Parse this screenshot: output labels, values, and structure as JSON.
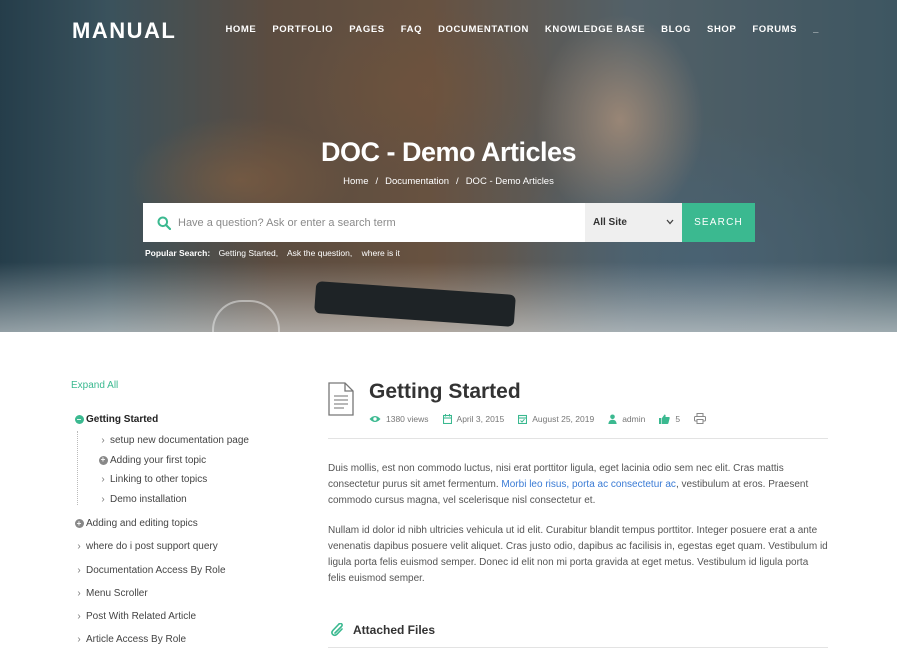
{
  "header": {
    "logo": "MANUAL",
    "nav": [
      "HOME",
      "PORTFOLIO",
      "PAGES",
      "FAQ",
      "DOCUMENTATION",
      "KNOWLEDGE BASE",
      "BLOG",
      "SHOP",
      "FORUMS",
      "_"
    ]
  },
  "hero": {
    "title": "DOC - Demo Articles",
    "breadcrumb": [
      "Home",
      "Documentation",
      "DOC - Demo Articles"
    ],
    "breadcrumb_sep": "/"
  },
  "search": {
    "placeholder": "Have a question? Ask or enter a search term",
    "scope": "All Site",
    "button": "SEARCH",
    "popular_label": "Popular Search:",
    "popular": [
      "Getting Started,",
      "Ask the question,",
      "where is it"
    ]
  },
  "colors": {
    "accent": "#3bb990",
    "link": "#3a7bd5"
  },
  "sidebar": {
    "expand_all": "Expand All",
    "items": [
      {
        "label": "Getting Started",
        "icon": "minus-circle-icon",
        "active": true,
        "children": [
          {
            "label": "setup new documentation page",
            "icon": "chevron-right-icon"
          },
          {
            "label": "Adding your first topic",
            "icon": "plus-circle-icon"
          },
          {
            "label": "Linking to other topics",
            "icon": "chevron-right-icon"
          },
          {
            "label": "Demo installation",
            "icon": "chevron-right-icon"
          }
        ]
      },
      {
        "label": "Adding and editing topics",
        "icon": "plus-circle-icon"
      },
      {
        "label": "where do i post support query",
        "icon": "chevron-right-icon"
      },
      {
        "label": "Documentation Access By Role",
        "icon": "chevron-right-icon"
      },
      {
        "label": "Menu Scroller",
        "icon": "chevron-right-icon"
      },
      {
        "label": "Post With Related Article",
        "icon": "chevron-right-icon"
      },
      {
        "label": "Article Access By Role",
        "icon": "chevron-right-icon"
      }
    ]
  },
  "article": {
    "title": "Getting Started",
    "meta": {
      "views": "1380 views",
      "published": "April 3, 2015",
      "updated": "August 25, 2019",
      "author": "admin",
      "likes": "5"
    },
    "p1_before": "Duis mollis, est non commodo luctus, nisi erat porttitor ligula, eget lacinia odio sem nec elit. Cras mattis consectetur purus sit amet fermentum. ",
    "p1_link": "Morbi leo risus, porta ac consectetur ac",
    "p1_after": ", vestibulum at eros. Praesent commodo cursus magna, vel scelerisque nisl consectetur et.",
    "p2": "Nullam id dolor id nibh ultricies vehicula ut id elit. Curabitur blandit tempus porttitor. Integer posuere erat a ante venenatis dapibus posuere velit aliquet. Cras justo odio, dapibus ac facilisis in, egestas eget quam. Vestibulum id ligula porta felis euismod semper. Donec id elit non mi porta gravida at eget metus. Vestibulum id ligula porta felis euismod semper.",
    "attached_files": "Attached Files"
  }
}
